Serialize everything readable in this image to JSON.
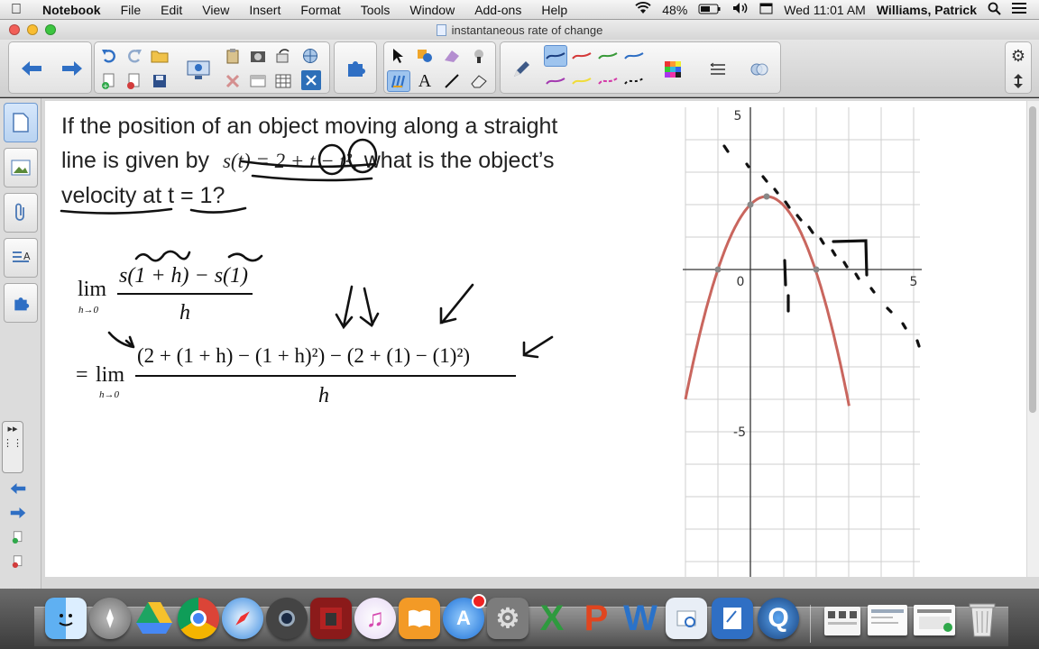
{
  "menubar": {
    "apple": "",
    "items": [
      "Notebook",
      "File",
      "Edit",
      "View",
      "Insert",
      "Format",
      "Tools",
      "Window",
      "Add-ons",
      "Help"
    ],
    "battery": "48%",
    "clock": "Wed 11:01 AM",
    "user": "Williams, Patrick"
  },
  "window": {
    "title": "instantaneous rate of change"
  },
  "problem": {
    "line1": "If the position of an object moving along a straight",
    "line2_a": "line is given by",
    "line2_b": ", what is the object’s",
    "line3": "velocity at t = 1?",
    "formula": "s(t) = 2 + t − t²"
  },
  "work": {
    "lim": "lim",
    "sub": "h→0",
    "eq": "=",
    "num1": "s(1 + h) − s(1)",
    "den": "h",
    "num2": "(2 + (1 + h) − (1 + h)²) − (2 + (1) − (1)²)"
  },
  "graph": {
    "tick_y_top": "5",
    "tick_y_bottom": "-5",
    "tick_x_origin": "0",
    "tick_x_right": "5",
    "curve_color": "#c9665e"
  },
  "colors": {
    "accent": "#2f6fc4",
    "selected": "#9ec4ee"
  }
}
